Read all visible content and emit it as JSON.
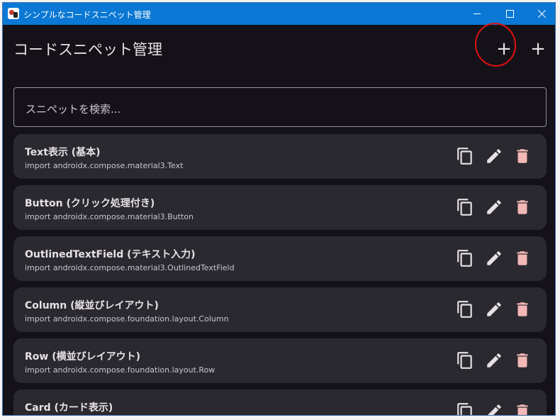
{
  "window": {
    "title": "シンプルなコードスニペット管理",
    "controls": {
      "minimize": "minimize-icon",
      "maximize": "maximize-icon",
      "close": "close-icon"
    }
  },
  "header": {
    "title": "コードスニペット管理",
    "add_buttons": [
      "+",
      "+"
    ]
  },
  "search": {
    "placeholder": "スニペットを検索..."
  },
  "snippets": [
    {
      "title": "Text表示 (基本)",
      "import": "import androidx.compose.material3.Text"
    },
    {
      "title": "Button (クリック処理付き)",
      "import": "import androidx.compose.material3.Button"
    },
    {
      "title": "OutlinedTextField (テキスト入力)",
      "import": "import androidx.compose.material3.OutlinedTextField"
    },
    {
      "title": "Column (縦並びレイアウト)",
      "import": "import androidx.compose.foundation.layout.Column"
    },
    {
      "title": "Row (横並びレイアウト)",
      "import": "import androidx.compose.foundation.layout.Row"
    },
    {
      "title": "Card (カード表示)",
      "import": ""
    }
  ],
  "colors": {
    "titlebar": "#0a78d4",
    "background": "#141218",
    "card": "#2b2930",
    "delete_icon": "#f2b8b5",
    "annotation": "#e01010"
  }
}
